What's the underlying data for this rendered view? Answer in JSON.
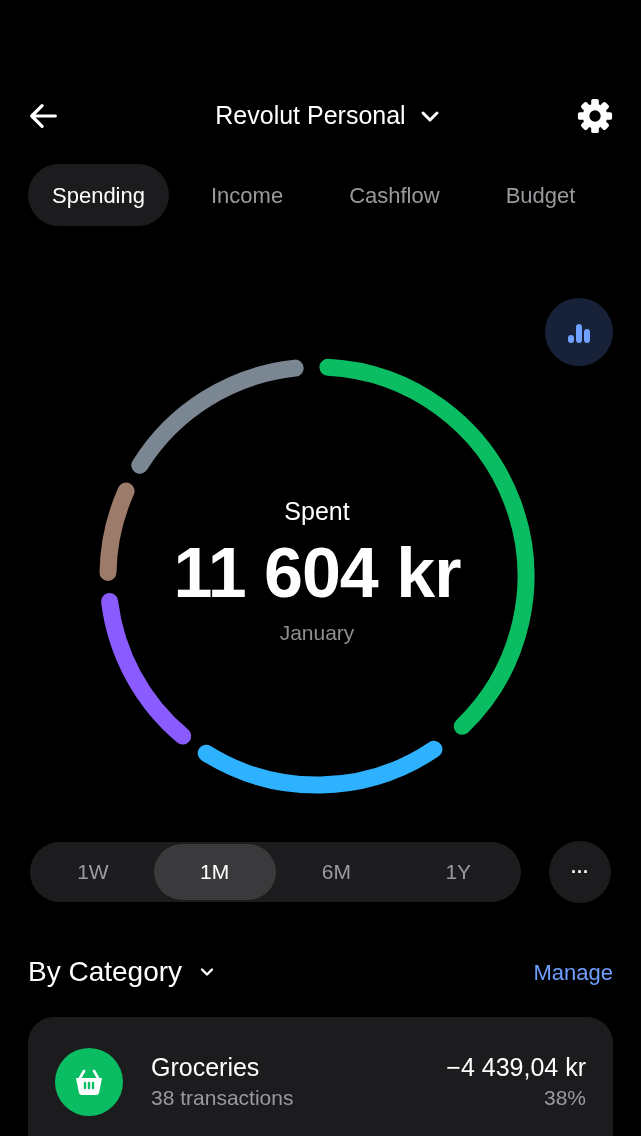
{
  "header": {
    "title": "Revolut Personal"
  },
  "tabs": [
    {
      "label": "Spending",
      "selected": true
    },
    {
      "label": "Income",
      "selected": false
    },
    {
      "label": "Cashflow",
      "selected": false
    },
    {
      "label": "Budget",
      "selected": false
    }
  ],
  "summary": {
    "label": "Spent",
    "amount": "11 604 kr",
    "period": "January"
  },
  "ring_segments": [
    {
      "color": "#0bbd62"
    },
    {
      "color": "#2eb2ff"
    },
    {
      "color": "#8a5cff"
    },
    {
      "color": "#9c7b6a"
    },
    {
      "color": "#7a8691"
    }
  ],
  "periods": [
    {
      "label": "1W",
      "selected": false
    },
    {
      "label": "1M",
      "selected": true
    },
    {
      "label": "6M",
      "selected": false
    },
    {
      "label": "1Y",
      "selected": false
    }
  ],
  "more_button": "···",
  "section": {
    "title": "By Category",
    "action": "Manage"
  },
  "categories": [
    {
      "name": "Groceries",
      "count": "38 transactions",
      "amount": "−4 439,04 kr",
      "share": "38%",
      "color": "#0bbd62"
    }
  ]
}
